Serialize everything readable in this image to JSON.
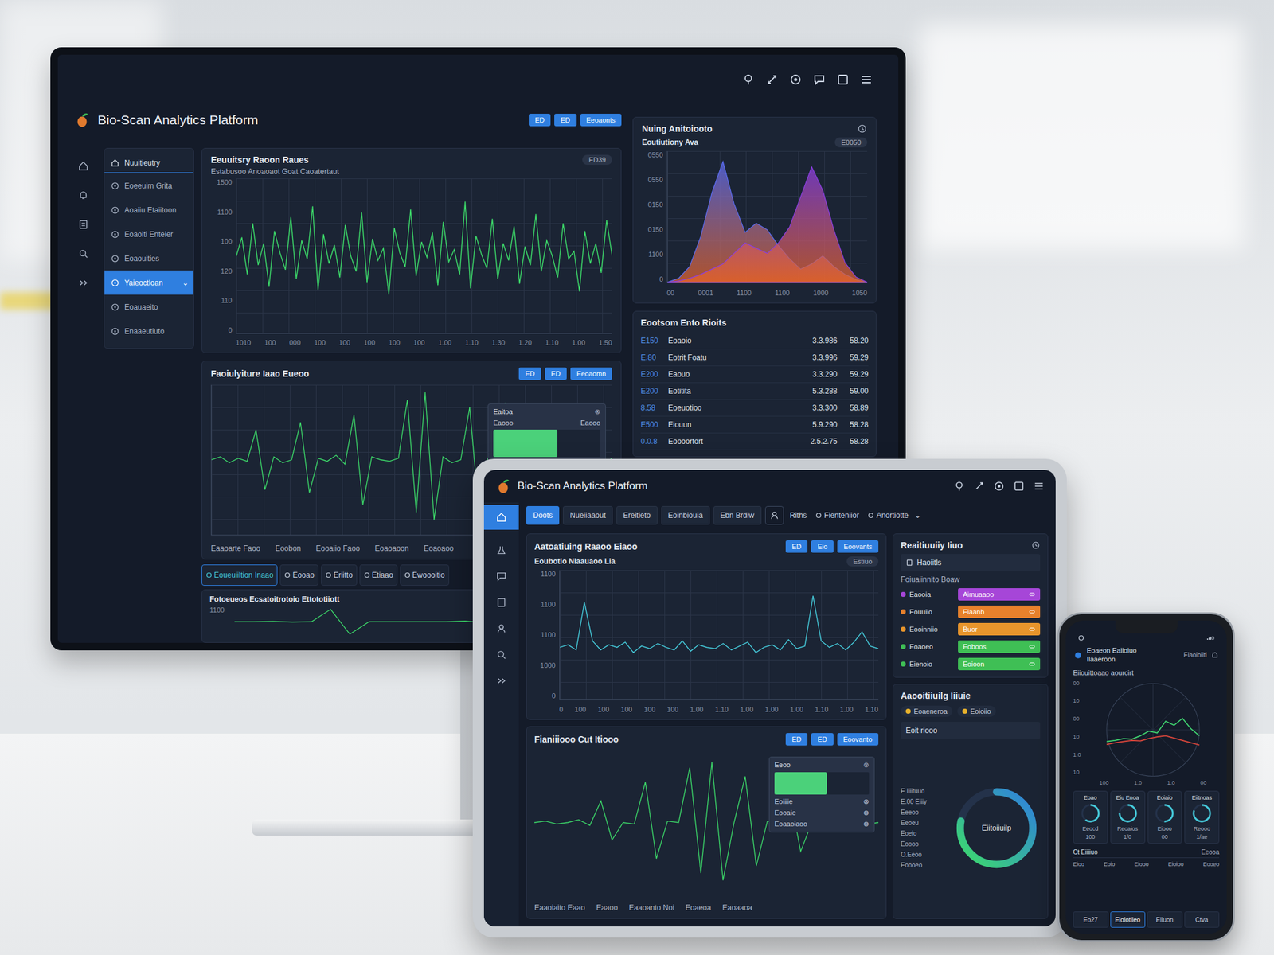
{
  "monitor": {
    "title": "Bio-Scan Analytics Platform",
    "buttons": [
      "ED",
      "ED",
      "Eeoaonts"
    ],
    "sidebar": {
      "heading": "Nuuitieutry",
      "expand_glyph": "⌄",
      "items": [
        {
          "label": "Eoeeuim Grita",
          "selected": false
        },
        {
          "label": "Aoaiiu Etaiitoon",
          "selected": false
        },
        {
          "label": "Eoaoiti Enteier",
          "selected": false
        },
        {
          "label": "Eoaouities",
          "selected": false
        },
        {
          "label": "Yaieoctloan",
          "selected": true
        },
        {
          "label": "Eoauaeito",
          "selected": false
        },
        {
          "label": "Enaaeutiuto",
          "selected": false
        }
      ]
    },
    "wave_panel": {
      "title": "Eeuuitsry Raoon Raues",
      "badge": "ED39",
      "subtitle": "Estabusoo Anoaoaot Goat Caoatertaut",
      "y_ticks": [
        "1500",
        "1100",
        "100",
        "120",
        "110",
        "0"
      ],
      "x_ticks": [
        "1010",
        "100",
        "000",
        "100",
        "100",
        "100",
        "100",
        "100",
        "1.00",
        "1.10",
        "1.30",
        "1.20",
        "1.10",
        "1.00",
        "1.50"
      ],
      "min": 0,
      "max": 100,
      "values": [
        50,
        62,
        38,
        71,
        44,
        58,
        30,
        66,
        52,
        41,
        75,
        35,
        60,
        48,
        82,
        28,
        64,
        45,
        57,
        36,
        70,
        50,
        40,
        78,
        33,
        61,
        47,
        55,
        25,
        68,
        52,
        43,
        80,
        37,
        59,
        49,
        65,
        31,
        72,
        46,
        54,
        38,
        85,
        29,
        63,
        51,
        42,
        74,
        35,
        58,
        47,
        69,
        32,
        56,
        44,
        77,
        40,
        60,
        50,
        36,
        71,
        48,
        53,
        27,
        66,
        45,
        58,
        39,
        73,
        50
      ]
    },
    "spike_panel": {
      "title": "Faoiulyiture Iaao Eueoo",
      "buttons": [
        "ED",
        "ED",
        "Eeoaomn"
      ],
      "x_labels": [
        "Eaaoarte Faoo",
        "Eoobon",
        "Eooaiio Faoo",
        "Eoaoaoon",
        "Eoaoaoo"
      ],
      "popup": {
        "title": "Eaitoa",
        "close": "⊗",
        "level": 0.6,
        "rows": [
          {
            "label": "Eaooo",
            "value": "Eaooo"
          }
        ]
      },
      "min": 0,
      "max": 100,
      "values": [
        50,
        52,
        48,
        51,
        49,
        70,
        30,
        52,
        48,
        50,
        75,
        28,
        51,
        49,
        53,
        47,
        80,
        20,
        52,
        50,
        49,
        51,
        90,
        15,
        95,
        10,
        52,
        48,
        50,
        85,
        18,
        51,
        49,
        88,
        12,
        50,
        52,
        47,
        60,
        42,
        51,
        49,
        50,
        52,
        48,
        51
      ]
    },
    "bottom_tabs": [
      {
        "label": "Eoueuiiltion Inaao",
        "selected": true
      },
      {
        "label": "Eooao",
        "selected": false
      },
      {
        "label": "Eriitto",
        "selected": false
      },
      {
        "label": "Etiaao",
        "selected": false
      },
      {
        "label": "Ewoooitio",
        "selected": false
      }
    ],
    "bottom_panel": {
      "title": "Fotoeueos Ecsatoitrotoio Ettototiiott",
      "y_tick": "1100",
      "min": 0,
      "max": 100,
      "values": [
        50,
        50,
        51,
        49,
        50,
        90,
        10,
        50,
        50,
        50,
        50,
        50,
        52,
        48,
        50,
        50,
        50,
        50,
        50,
        85,
        15,
        50
      ]
    },
    "density_panel": {
      "title": "Nuing Anitoiooto",
      "subtitle": "Eoutiutiony Ava",
      "badge": "E0050",
      "y_ticks": [
        "0550",
        "0550",
        "0150",
        "0150",
        "1100",
        "0"
      ],
      "x_ticks": [
        "00",
        "0001",
        "1100",
        "1100",
        "1000",
        "1050"
      ],
      "min": 0,
      "max": 100,
      "series": [
        {
          "values": [
            0,
            3,
            12,
            35,
            68,
            92,
            60,
            38,
            45,
            40,
            28,
            18,
            10,
            14,
            20,
            12,
            6,
            2,
            0
          ],
          "color": "#5b6cf0"
        },
        {
          "values": [
            0,
            1,
            3,
            6,
            10,
            14,
            22,
            30,
            26,
            22,
            30,
            42,
            65,
            88,
            70,
            40,
            15,
            4,
            0
          ],
          "color": "#8a3fe0"
        }
      ]
    },
    "table": {
      "title": "Eootsom Ento Rioits",
      "rows": [
        [
          "E150",
          "Eoaoio",
          "3.3.986",
          "58.20"
        ],
        [
          "E.80",
          "Eotrit Foatu",
          "3.3.996",
          "59.29"
        ],
        [
          "E200",
          "Eaouo",
          "3.3.290",
          "59.29"
        ],
        [
          "E200",
          "Eotitita",
          "5.3.288",
          "59.00"
        ],
        [
          "8.58",
          "Eoeuotioo",
          "3.3.300",
          "58.89"
        ],
        [
          "E500",
          "Eiouun",
          "5.9.290",
          "58.28"
        ],
        [
          "0.0.8",
          "Eoooortort",
          "2.5.2.75",
          "58.28"
        ]
      ]
    }
  },
  "tablet": {
    "title": "Bio-Scan Analytics Platform",
    "tabs": [
      {
        "label": "Doots",
        "selected": true
      },
      {
        "label": "Nueiiaaout",
        "selected": false
      },
      {
        "label": "Ereitieto",
        "selected": false
      },
      {
        "label": "Eoinbiouia",
        "selected": false
      },
      {
        "label": "Ebn Brdiw",
        "selected": false
      }
    ],
    "tools": [
      "Riths",
      "Fienteniior",
      "Anortiotte"
    ],
    "chevron": "⌄",
    "wave_panel": {
      "title": "Aatoatiuing Raaoo Eiaoo",
      "buttons": [
        "ED",
        "Eio",
        "Eoovants"
      ],
      "subtitle": "Eoubotio Nlaauaoo Lia",
      "badge": "Estiuo",
      "y_ticks": [
        "1100",
        "1100",
        "1100",
        "1000",
        "0"
      ],
      "x_ticks": [
        "0",
        "100",
        "100",
        "100",
        "100",
        "100",
        "1.00",
        "1.10",
        "1.00",
        "1.00",
        "1.00",
        "1.10",
        "1.00",
        "1.10"
      ],
      "min": 0,
      "max": 100,
      "values": [
        40,
        42,
        38,
        75,
        45,
        38,
        42,
        40,
        44,
        36,
        41,
        39,
        43,
        40,
        38,
        45,
        37,
        42,
        40,
        39,
        43,
        38,
        41,
        44,
        36,
        40,
        42,
        38,
        46,
        39,
        41,
        80,
        45,
        40,
        43,
        38,
        44,
        52,
        41,
        39
      ]
    },
    "spike_panel": {
      "title": "Fianiiiooo Cut Itiooo",
      "buttons": [
        "ED",
        "ED",
        "Eoovanto"
      ],
      "x_labels": [
        "Eaaoiaito Eaao",
        "Eaaoo",
        "Eaaoanto Noi",
        "Eoaeoa",
        "Eaoaaoa"
      ],
      "popup": {
        "title": "Eeoo",
        "close": "⊗",
        "level": 0.55,
        "rows": [
          {
            "label": "Eoiiiie",
            "value": "⊗"
          },
          {
            "label": "Eooaie",
            "value": "⊗"
          },
          {
            "label": "Eoaaoiaoo",
            "value": "⊗"
          }
        ]
      },
      "min": 0,
      "max": 100,
      "values": [
        50,
        51,
        49,
        50,
        52,
        48,
        65,
        38,
        50,
        49,
        78,
        25,
        51,
        50,
        88,
        15,
        92,
        10,
        50,
        82,
        20,
        51,
        49,
        70,
        30,
        50,
        52,
        48,
        50,
        51,
        49,
        50
      ]
    },
    "status_panel": {
      "title": "Reaitiuuiiy Iiuo",
      "section": "Haoiitls",
      "subtitle": "Foiuaiinnito Boaw",
      "rows": [
        {
          "label": "Eaooia",
          "tag": "Aimuaaoo",
          "color": "#a646d8"
        },
        {
          "label": "Eouuiio",
          "tag": "Eiaanb",
          "color": "#e8812c"
        },
        {
          "label": "Eooinniio",
          "tag": "Buor",
          "color": "#e8952c"
        },
        {
          "label": "Eoaoeo",
          "tag": "Eoboos",
          "color": "#3fbf55"
        },
        {
          "label": "Eienoio",
          "tag": "Eoioon",
          "color": "#3fbf55"
        }
      ]
    },
    "gauge_panel": {
      "title": "Aaooitiiuilg Iiiuie",
      "chips": [
        "Eoaeneroa",
        "Eoioiio"
      ],
      "section": "Eoit riooo",
      "labels": [
        "E Iiiituuo",
        "E.00 Eiiiy",
        "Eeeoo",
        "Eeoeu",
        "Eoeio",
        "Eoooo",
        "O.Eeoo",
        "Eoooeo"
      ],
      "center": "Eiitoiiuilp",
      "level": 0.78
    }
  },
  "phone": {
    "title": "Eoaeon Eaiioiuo",
    "title2": "Ilaaeroon",
    "action": "Eiaoioiiti",
    "subtitle": "Eiiouittoaao aourcirt",
    "chart": {
      "y_ticks": [
        "00",
        "10",
        "00",
        "10",
        "1.0",
        "10"
      ],
      "x_ticks": [
        "100",
        "1.0",
        "1.0",
        "00"
      ],
      "min": 0,
      "max": 80,
      "series": [
        {
          "values": [
            20,
            22,
            25,
            24,
            30,
            38,
            35,
            55,
            48,
            60,
            42,
            30
          ],
          "color": "#3fd16f"
        },
        {
          "values": [
            15,
            18,
            20,
            22,
            21,
            25,
            28,
            30,
            26,
            22,
            18,
            14
          ],
          "color": "#d9463b"
        }
      ]
    },
    "tiles": [
      {
        "title": "Eoao",
        "label": "Eeocd",
        "value": "100",
        "level": 0.6
      },
      {
        "title": "Eiu Enoa",
        "label": "Reoaios",
        "value": "1/0",
        "level": 0.75
      },
      {
        "title": "Eoiaio",
        "label": "Eiooo",
        "value": "00",
        "level": 0.5
      },
      {
        "title": "Eiitnoas",
        "label": "Reooo",
        "value": "1/ae",
        "level": 0.8
      }
    ],
    "list": {
      "title": "Ct Eiiiiuo",
      "action": "Eeooa",
      "items": [
        "Eioo",
        "Eoio",
        "Eiooo",
        "Eioioo",
        "Eooeo"
      ]
    },
    "nav": [
      {
        "label": "Eo27",
        "selected": false
      },
      {
        "label": "Eioiotiieo",
        "selected": true
      },
      {
        "label": "Eiiuon",
        "selected": false
      },
      {
        "label": "Ctva",
        "selected": false
      }
    ]
  }
}
